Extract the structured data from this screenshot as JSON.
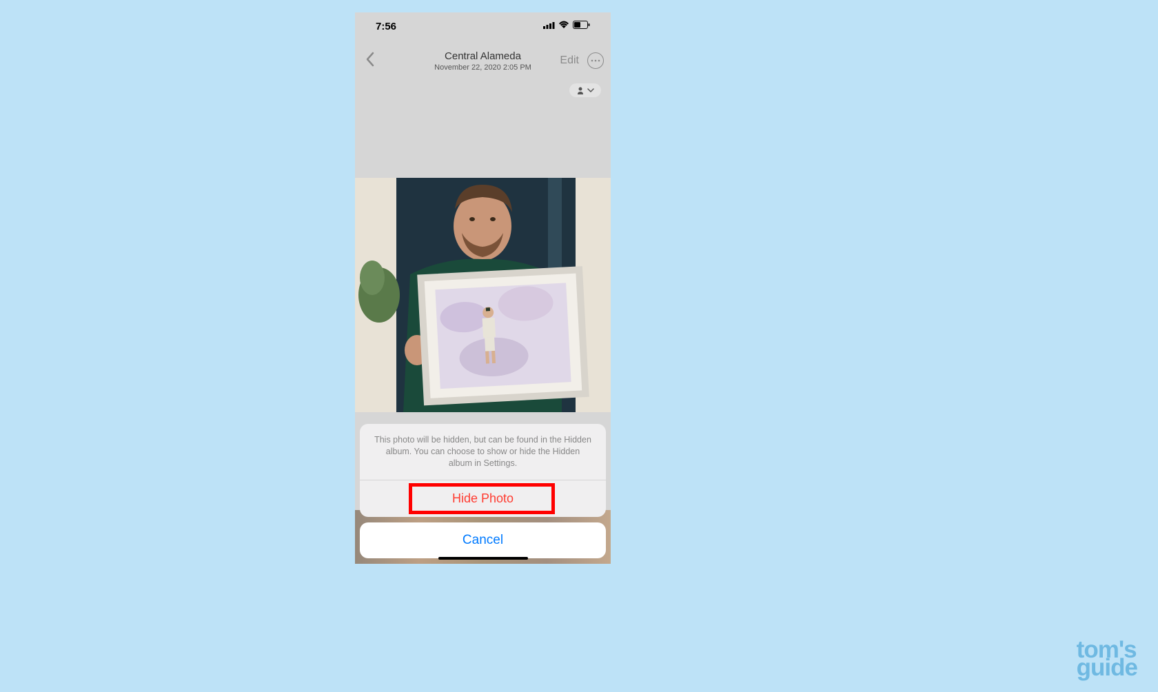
{
  "status_bar": {
    "time": "7:56"
  },
  "nav": {
    "title": "Central Alameda",
    "subtitle": "November 22, 2020  2:05 PM",
    "edit_label": "Edit"
  },
  "action_sheet": {
    "message": "This photo will be hidden, but can be found in the Hidden album. You can choose to show or hide the Hidden album in Settings.",
    "hide_label": "Hide Photo",
    "cancel_label": "Cancel"
  },
  "watermark": {
    "line1": "tom's",
    "line2": "guide"
  }
}
